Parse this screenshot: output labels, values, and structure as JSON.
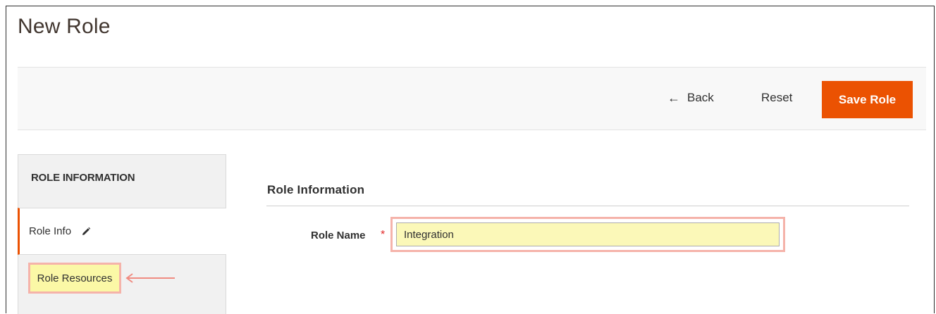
{
  "page": {
    "title": "New Role"
  },
  "toolbar": {
    "back_label": "Back",
    "reset_label": "Reset",
    "save_label": "Save Role",
    "save_color": "#eb5202"
  },
  "sidebar": {
    "title": "ROLE INFORMATION",
    "tabs": [
      {
        "label": "Role Info",
        "icon": "pencil-icon",
        "active": true
      },
      {
        "label": "Role Resources",
        "highlighted": true
      }
    ]
  },
  "form": {
    "section_title": "Role Information",
    "role_name_label": "Role Name",
    "required_marker": "*",
    "role_name_value": "Integration"
  },
  "colors": {
    "accent": "#eb5202",
    "highlight_fill": "#fbf8a6",
    "highlight_border": "#f5b3aa",
    "required": "#e22626"
  }
}
